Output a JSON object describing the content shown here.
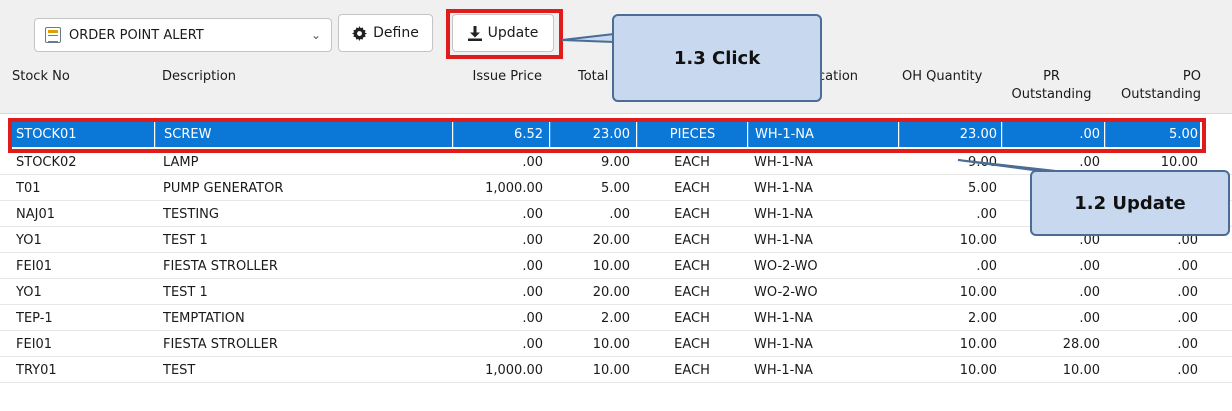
{
  "toolbar": {
    "report_select": "ORDER POINT ALERT",
    "define_label": "Define",
    "update_label": "Update"
  },
  "columns": [
    "Stock No",
    "Description",
    "Issue Price",
    "Total",
    "cation",
    "OH Quantity",
    "PR\nOutstanding",
    "PO\nOutstanding"
  ],
  "rows": [
    [
      "STOCK01",
      "SCREW",
      "6.52",
      "23.00",
      "PIECES",
      "WH-1-NA",
      "23.00",
      ".00",
      "5.00"
    ],
    [
      "STOCK02",
      "LAMP",
      ".00",
      "9.00",
      "EACH",
      "WH-1-NA",
      "9.00",
      ".00",
      "10.00"
    ],
    [
      "T01",
      "PUMP GENERATOR",
      "1,000.00",
      "5.00",
      "EACH",
      "WH-1-NA",
      "5.00",
      "",
      ""
    ],
    [
      "NAJ01",
      "TESTING",
      ".00",
      ".00",
      "EACH",
      "WH-1-NA",
      ".00",
      "",
      ""
    ],
    [
      "YO1",
      "TEST 1",
      ".00",
      "20.00",
      "EACH",
      "WH-1-NA",
      "10.00",
      ".00",
      ".00"
    ],
    [
      "FEI01",
      "FIESTA STROLLER",
      ".00",
      "10.00",
      "EACH",
      "WO-2-WO",
      ".00",
      ".00",
      ".00"
    ],
    [
      "YO1",
      "TEST 1",
      ".00",
      "20.00",
      "EACH",
      "WO-2-WO",
      "10.00",
      ".00",
      ".00"
    ],
    [
      "TEP-1",
      "TEMPTATION",
      ".00",
      "2.00",
      "EACH",
      "WH-1-NA",
      "2.00",
      ".00",
      ".00"
    ],
    [
      "FEI01",
      "FIESTA STROLLER",
      ".00",
      "10.00",
      "EACH",
      "WH-1-NA",
      "10.00",
      "28.00",
      ".00"
    ],
    [
      "TRY01",
      "TEST",
      "1,000.00",
      "10.00",
      "EACH",
      "WH-1-NA",
      "10.00",
      "10.00",
      ".00"
    ]
  ],
  "callouts": {
    "click": "1.3 Click",
    "update": "1.2 Update"
  },
  "colors": {
    "selection": "#0b78d7",
    "highlight": "#e01b1b",
    "callout_fill": "#c8d9ef",
    "callout_border": "#4a6c95"
  }
}
